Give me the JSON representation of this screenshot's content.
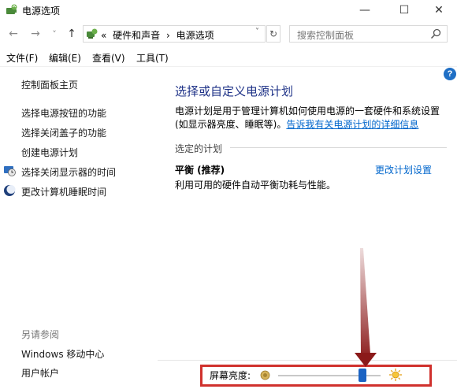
{
  "window": {
    "title": "电源选项",
    "controls": {
      "minimize": "—",
      "maximize": "☐",
      "close": "✕"
    }
  },
  "nav": {
    "back": "←",
    "forward": "→",
    "dropdown": "˅",
    "up": "↑"
  },
  "address": {
    "prefix": "«",
    "crumbs": [
      "硬件和声音",
      "›",
      "电源选项"
    ],
    "dropdown": "˅",
    "refresh": "↻"
  },
  "search": {
    "placeholder": "搜索控制面板"
  },
  "menu": {
    "file": "文件(F)",
    "edit": "编辑(E)",
    "view": "查看(V)",
    "tools": "工具(T)"
  },
  "sidebar": {
    "home": "控制面板主页",
    "items": [
      "选择电源按钮的功能",
      "选择关闭盖子的功能",
      "创建电源计划",
      "选择关闭显示器的时间",
      "更改计算机睡眠时间"
    ],
    "see_also": "另请参阅",
    "see_also_items": [
      "Windows 移动中心",
      "用户帐户"
    ]
  },
  "help": "?",
  "main": {
    "title": "选择或自定义电源计划",
    "description": "电源计划是用于管理计算机如何使用电源的一套硬件和系统设置(如显示器亮度、睡眠等)。",
    "description_link": "告诉我有关电源计划的详细信息",
    "section_label": "选定的计划",
    "plan": {
      "name": "平衡 (推荐)",
      "change_link": "更改计划设置",
      "description": "利用可用的硬件自动平衡功耗与性能。"
    }
  },
  "brightness": {
    "label": "屏幕亮度:",
    "level_fraction": 0.82,
    "highlight_color": "#d0312d",
    "thumb_color": "#1b63c3"
  },
  "colors": {
    "title_blue": "#1e3287",
    "link_blue": "#0066cc",
    "annotation_arrow": "#8b1a1a"
  }
}
